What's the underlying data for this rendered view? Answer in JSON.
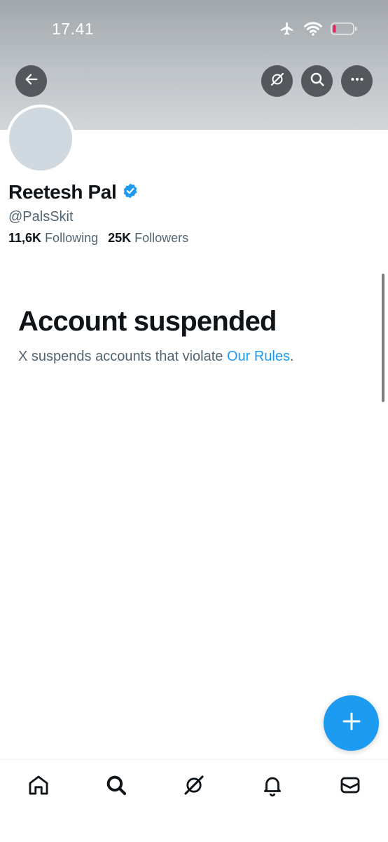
{
  "status_bar": {
    "time": "17.41"
  },
  "header": {
    "back_icon": "arrow-left-icon",
    "grok_icon": "grok-icon",
    "search_icon": "search-icon",
    "more_icon": "more-horizontal-icon"
  },
  "profile": {
    "name": "Reetesh Pal",
    "verified": true,
    "handle": "@PalsSkit",
    "following_count": "11,6K",
    "following_label": "Following",
    "followers_count": "25K",
    "followers_label": "Followers"
  },
  "suspension": {
    "title": "Account suspended",
    "message": "X suspends accounts that violate",
    "link": "Our Rules",
    "end": "."
  },
  "fab": {
    "icon": "plus-icon"
  },
  "tabbar": {
    "items": [
      "home-icon",
      "search-icon",
      "grok-icon",
      "notifications-icon",
      "messages-icon"
    ]
  },
  "colors": {
    "accent": "#1d9bf0",
    "battery_low": "#e0245e"
  }
}
